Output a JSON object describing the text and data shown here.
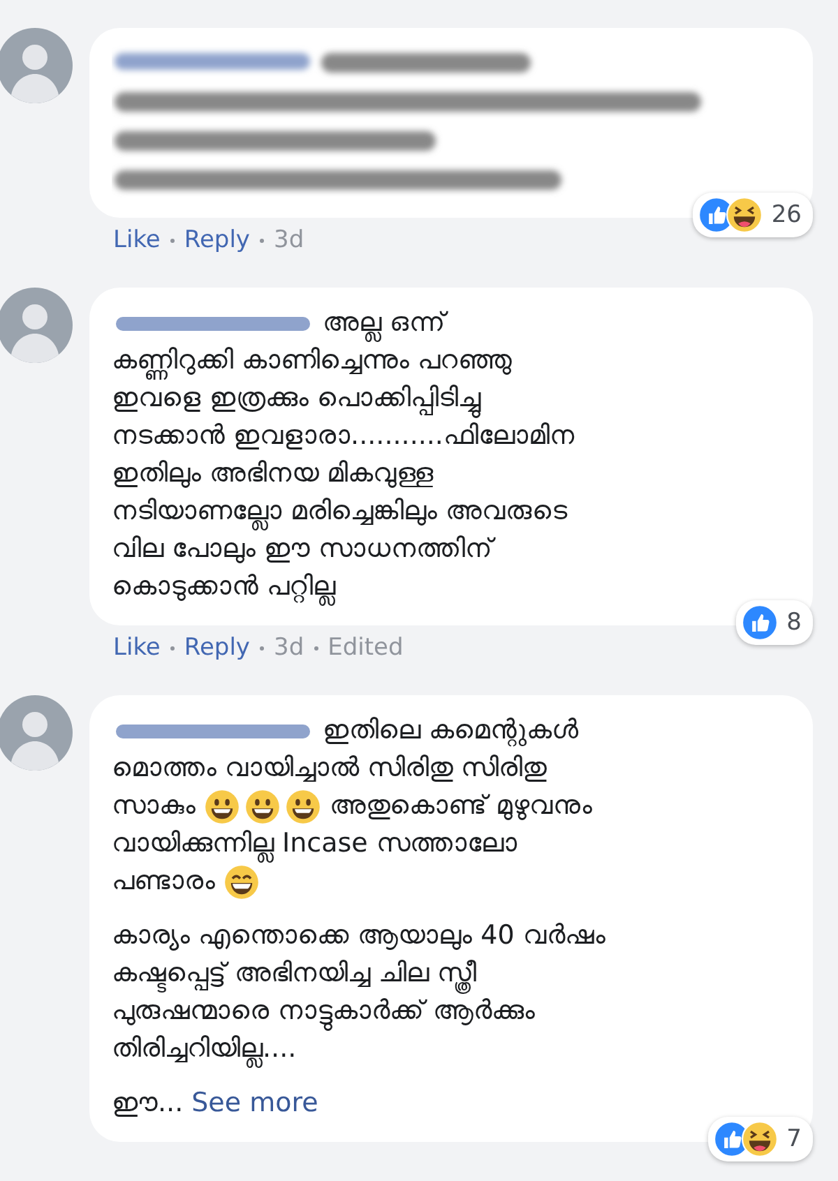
{
  "comments": [
    {
      "body": {
        "kind": "blurred"
      },
      "meta": [
        {
          "kind": "link",
          "text": "Like"
        },
        {
          "kind": "link",
          "text": "Reply"
        },
        {
          "kind": "info",
          "text": "3d"
        }
      ],
      "reactions": {
        "items": [
          {
            "kind": "like"
          },
          {
            "kind": "haha"
          }
        ],
        "count": "26"
      }
    },
    {
      "body": {
        "kind": "text",
        "paragraphs": [
          [
            [
              {
                "kind": "text",
                "text": "അല്ല ഒന്ന്"
              }
            ],
            [
              {
                "kind": "text",
                "text": "കണ്ണിറുക്കി കാണിച്ചെന്നും പറഞ്ഞു"
              }
            ],
            [
              {
                "kind": "text",
                "text": "ഇവളെ ഇത്രക്കും പൊക്കിപ്പിടിച്ചു"
              }
            ],
            [
              {
                "kind": "text",
                "text": "നടക്കാൻ ഇവളാരാ...........ഫിലോമിന"
              }
            ],
            [
              {
                "kind": "text",
                "text": "ഇതിലും അഭിനയ മികവുള്ള"
              }
            ],
            [
              {
                "kind": "text",
                "text": "നടിയാണല്ലോ മരിച്ചെങ്കിലും അവരുടെ"
              }
            ],
            [
              {
                "kind": "text",
                "text": "വില പോലും ഈ സാധനത്തിന്"
              }
            ],
            [
              {
                "kind": "text",
                "text": "കൊടുക്കാൻ പറ്റില്ല"
              }
            ]
          ]
        ]
      },
      "meta": [
        {
          "kind": "link",
          "text": "Like"
        },
        {
          "kind": "link",
          "text": "Reply"
        },
        {
          "kind": "info",
          "text": "3d"
        },
        {
          "kind": "info",
          "text": "Edited"
        }
      ],
      "reactions": {
        "items": [
          {
            "kind": "like"
          }
        ],
        "count": "8"
      }
    },
    {
      "body": {
        "kind": "text",
        "paragraphs": [
          [
            [
              {
                "kind": "text",
                "text": "ഇതിലെ കമെന്റുകൾ"
              }
            ],
            [
              {
                "kind": "text",
                "text": "മൊത്തം വായിച്ചാൽ സിരിതു സിരിതു"
              }
            ],
            [
              {
                "kind": "text",
                "text": "സാകും"
              },
              {
                "kind": "smile"
              },
              {
                "kind": "smile"
              },
              {
                "kind": "smile"
              },
              {
                "kind": "text",
                "text": "അതുകൊണ്ട് മുഴുവനും"
              }
            ],
            [
              {
                "kind": "text",
                "text": "വായിക്കുന്നില്ല Incase സത്താലോ"
              }
            ],
            [
              {
                "kind": "text",
                "text": "പണ്ടാരം"
              },
              {
                "kind": "grin"
              }
            ]
          ],
          [
            [
              {
                "kind": "text",
                "text": "കാര്യം എന്തൊക്കെ ആയാലും 40 വർഷം"
              }
            ],
            [
              {
                "kind": "text",
                "text": "കഷ്ടപ്പെട്ട് അഭിനയിച്ച ചില സ്ത്രീ"
              }
            ],
            [
              {
                "kind": "text",
                "text": "പുരുഷന്മാരെ നാട്ടുകാർക്ക് ആർക്കും"
              }
            ],
            [
              {
                "kind": "text",
                "text": "തിരിച്ചറിയില്ല...."
              }
            ]
          ],
          [
            [
              {
                "kind": "text",
                "text": "ഈ..."
              },
              {
                "kind": "link",
                "text": "See more"
              }
            ]
          ]
        ]
      },
      "reactions": {
        "items": [
          {
            "kind": "like"
          },
          {
            "kind": "haha"
          }
        ],
        "count": "7"
      }
    }
  ]
}
